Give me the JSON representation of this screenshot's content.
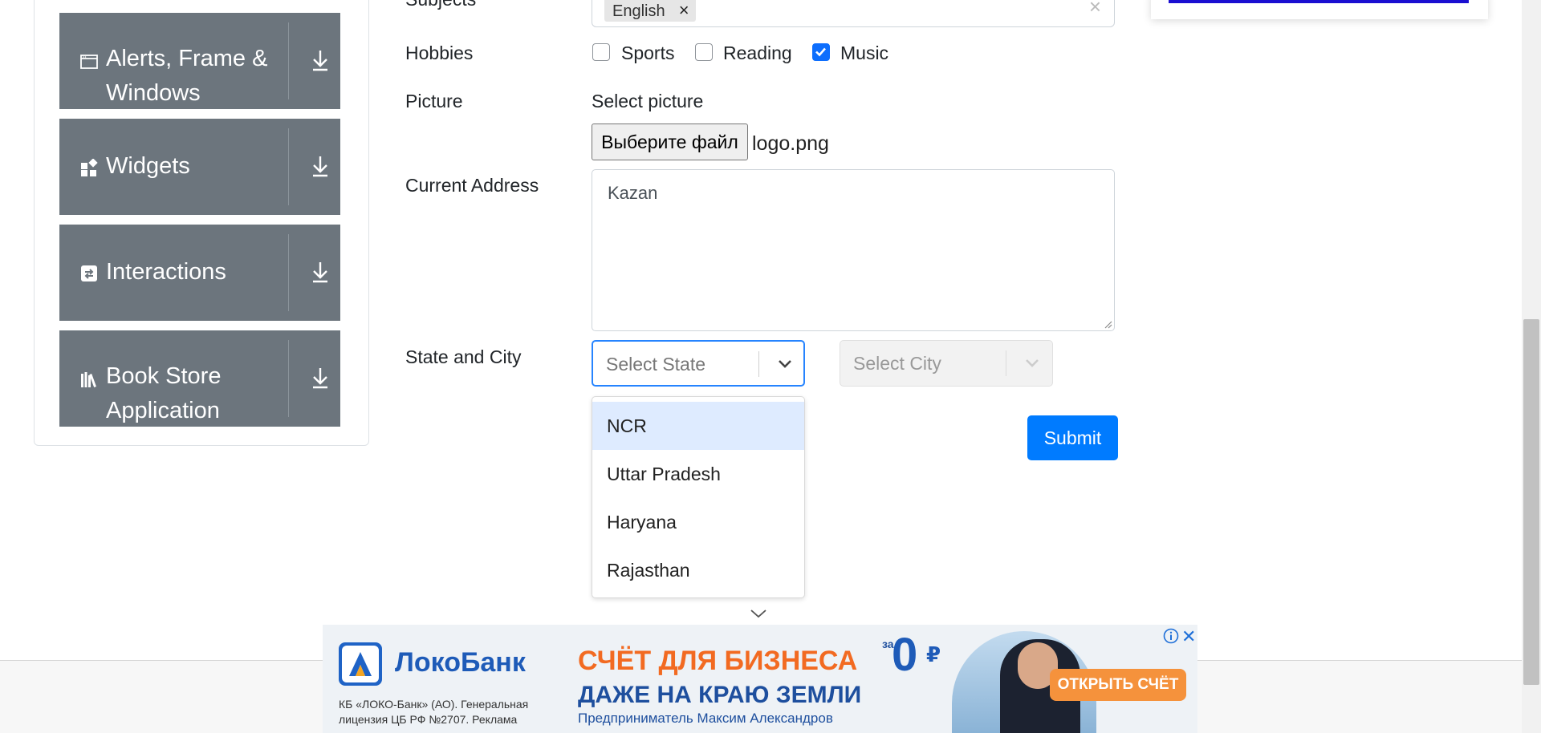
{
  "sidebar": {
    "groups": [
      {
        "label": "Alerts, Frame & Windows",
        "icon": "browser-window-icon"
      },
      {
        "label": "Widgets",
        "icon": "widgets-grid-icon"
      },
      {
        "label": "Interactions",
        "icon": "interactions-swap-icon"
      },
      {
        "label": "Book Store Application",
        "icon": "book-store-icon"
      }
    ]
  },
  "form": {
    "subjects_label": "Subjects",
    "subjects_chip": "English",
    "hobbies_label": "Hobbies",
    "hobbies": [
      {
        "label": "Sports",
        "checked": false
      },
      {
        "label": "Reading",
        "checked": false
      },
      {
        "label": "Music",
        "checked": true
      }
    ],
    "picture_label": "Picture",
    "picture_prompt": "Select picture",
    "file_button": "Выберите файл",
    "file_name": "logo.png",
    "address_label": "Current Address",
    "address_value": "Kazan",
    "state_city_label": "State and City",
    "state_placeholder": "Select State",
    "city_placeholder": "Select City",
    "state_options": [
      "NCR",
      "Uttar Pradesh",
      "Haryana",
      "Rajasthan"
    ],
    "focused_option": "NCR",
    "submit_label": "Submit"
  },
  "banner": {
    "bank_name": "ЛокоБанк",
    "legal_text": "КБ «ЛОКО-Банк» (АО). Генеральная лицензия ЦБ РФ №2707. Реклама",
    "headline": "СЧЁТ ДЛЯ БИЗНЕСА",
    "subheadline": "ДАЖЕ НА КРАЮ ЗЕМЛИ",
    "caption": "Предприниматель Максим Александров",
    "price_prefix": "за",
    "price": "0",
    "price_currency": "₽",
    "cta": "ОТКРЫТЬ СЧЁТ"
  },
  "colors": {
    "sidebar_bg": "#6c757d",
    "accent": "#007bff",
    "checkbox_checked": "#0d6efd",
    "select_focus": "#2684ff",
    "option_focus": "#deebff",
    "ad_orange": "#f26a21",
    "ad_blue": "#1e5bb8"
  }
}
